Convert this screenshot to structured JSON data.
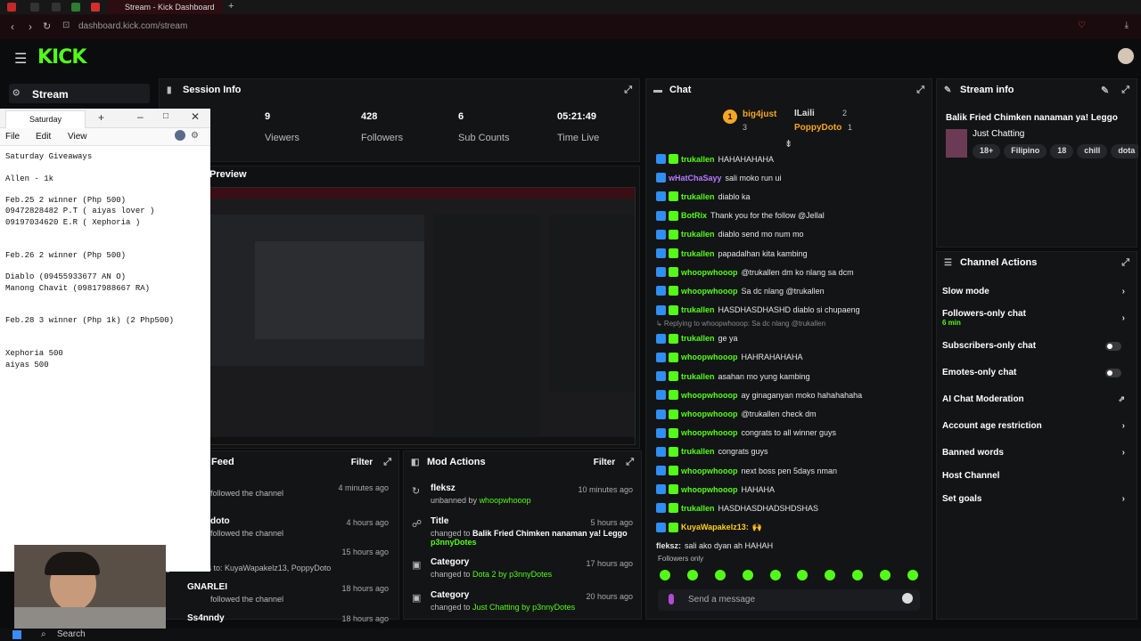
{
  "browser": {
    "tab_title": "Stream - Kick Dashboard",
    "url": "dashboard.kick.com/stream"
  },
  "brand": {
    "logo_text": "KICK",
    "accent": "#53fc18"
  },
  "sidebar": {
    "stream_label": "Stream"
  },
  "session": {
    "title": "Session Info",
    "stats": [
      {
        "value": "9",
        "label": "Viewers"
      },
      {
        "value": "428",
        "label": "Followers"
      },
      {
        "value": "6",
        "label": "Sub Counts"
      },
      {
        "value": "05:21:49",
        "label": "Time Live"
      }
    ],
    "preview_label": "Preview"
  },
  "notepad": {
    "tab_title": "Saturday",
    "menu": [
      "File",
      "Edit",
      "View"
    ],
    "lines": [
      "Saturday Giveaways",
      "",
      "Allen - 1k",
      "",
      "Feb.25 2 winner (Php 500)",
      "09472828482 P.T ( aiyas lover )",
      "09197034620 E.R ( Xephoria )",
      "",
      "",
      "Feb.26 2 winner (Php 500)",
      "",
      "Diablo (09455933677 AN O)",
      "Manong Chavit (09817988667 RA)",
      "",
      "",
      "Feb.28 3 winner (Php 1k) (2 Php500)",
      "",
      "",
      "Xephoria 500",
      "aiyas 500"
    ]
  },
  "feed": {
    "title": "Feed",
    "filter_label": "Filter",
    "items": [
      {
        "title": "",
        "sub": "followed the channel",
        "time": "4 minutes ago"
      },
      {
        "title": "doto",
        "sub": "followed the channel",
        "time": "4 hours ago"
      },
      {
        "title": "",
        "sub": "gifted 2 subs to: KuyaWapakelz13, PoppyDoto",
        "time": "15 hours ago"
      },
      {
        "title": "GNARLEI",
        "sub": "followed the channel",
        "time": "18 hours ago"
      },
      {
        "title": "Ss4nndy",
        "sub": "",
        "time": "18 hours ago"
      }
    ]
  },
  "mod_actions": {
    "title": "Mod Actions",
    "filter_label": "Filter",
    "items": [
      {
        "title": "fleksz",
        "sub_prefix": "unbanned by ",
        "sub_user": "whoopwhooop",
        "time": "10 minutes ago"
      },
      {
        "title": "Title",
        "sub_prefix": "changed to ",
        "sub_user": "Balik Fried Chimken nanaman ya! Leggo",
        "sub2": "p3nnyDotes",
        "time": "5 hours ago"
      },
      {
        "title": "Category",
        "sub_prefix": "changed to ",
        "sub_user": "Dota 2 by p3nnyDotes",
        "time": "17 hours ago"
      },
      {
        "title": "Category",
        "sub_prefix": "changed to ",
        "sub_user": "Just Chatting by p3nnyDotes",
        "time": "20 hours ago"
      }
    ]
  },
  "chat": {
    "title": "Chat",
    "top_gifters": [
      {
        "rank": "1",
        "name": "big4just",
        "count": "3"
      },
      {
        "rank": "",
        "name": "ILaili",
        "count": "2"
      },
      {
        "rank": "",
        "name": "PoppyDoto",
        "count": "1"
      }
    ],
    "messages": [
      {
        "user": "trukallen",
        "color": "#53fc18",
        "text": "HAHAHAHAHA",
        "badges": [
          "blue",
          "green"
        ]
      },
      {
        "user": "wHatChaSayy",
        "color": "#b57bff",
        "text": "sali moko run ui",
        "badges": [
          "blue"
        ]
      },
      {
        "user": "trukallen",
        "color": "#53fc18",
        "text": "diablo ka",
        "badges": [
          "blue",
          "green"
        ]
      },
      {
        "user": "BotRix",
        "color": "#53fc18",
        "text": "Thank you for the follow @Jellal",
        "badges": [
          "blue",
          "green"
        ]
      },
      {
        "user": "trukallen",
        "color": "#53fc18",
        "text": "diablo send mo num mo",
        "badges": [
          "blue",
          "green"
        ]
      },
      {
        "user": "trukallen",
        "color": "#53fc18",
        "text": "papadalhan kita kambing",
        "badges": [
          "blue",
          "green"
        ]
      },
      {
        "user": "whoopwhooop",
        "color": "#53fc18",
        "text": "@trukallen dm ko nlang sa dcm",
        "badges": [
          "blue",
          "green"
        ]
      },
      {
        "user": "whoopwhooop",
        "color": "#53fc18",
        "text": "Sa dc nlang @trukallen",
        "badges": [
          "blue",
          "green"
        ]
      },
      {
        "user": "trukallen",
        "color": "#53fc18",
        "text": "HASDHASDHASHD diablo si chupaeng",
        "badges": [
          "blue",
          "green"
        ]
      },
      {
        "user": "trukallen",
        "color": "#53fc18",
        "text": "ge ya",
        "badges": [
          "blue",
          "green"
        ],
        "reply": "Replying to whoopwhooop: Sa dc nlang @trukallen"
      },
      {
        "user": "whoopwhooop",
        "color": "#53fc18",
        "text": "HAHRAHAHAHA",
        "badges": [
          "blue",
          "green"
        ]
      },
      {
        "user": "trukallen",
        "color": "#53fc18",
        "text": "asahan mo yung kambing",
        "badges": [
          "blue",
          "green"
        ]
      },
      {
        "user": "whoopwhooop",
        "color": "#53fc18",
        "text": "ay ginaganyan moko hahahahaha",
        "badges": [
          "blue",
          "green"
        ]
      },
      {
        "user": "whoopwhooop",
        "color": "#53fc18",
        "text": "@trukallen check dm",
        "badges": [
          "blue",
          "green"
        ]
      },
      {
        "user": "whoopwhooop",
        "color": "#53fc18",
        "text": "congrats to all winner guys",
        "badges": [
          "blue",
          "green"
        ]
      },
      {
        "user": "trukallen",
        "color": "#53fc18",
        "text": "congrats guys",
        "badges": [
          "blue",
          "green"
        ]
      },
      {
        "user": "whoopwhooop",
        "color": "#53fc18",
        "text": "next boss pen 5days nman",
        "badges": [
          "blue",
          "green"
        ]
      },
      {
        "user": "whoopwhooop",
        "color": "#53fc18",
        "text": "HAHAHA",
        "badges": [
          "blue",
          "green"
        ]
      },
      {
        "user": "trukallen",
        "color": "#53fc18",
        "text": "HASDHASDHADSHDSHAS",
        "badges": [
          "blue",
          "green"
        ]
      },
      {
        "user": "KuyaWapakelz13:",
        "color": "#ffd11a",
        "text": "🙌",
        "badges": [
          "blue",
          "green"
        ]
      },
      {
        "user": "fleksz:",
        "color": "#e6e6e6",
        "text": "sali ako dyan ah HAHAH",
        "badges": []
      }
    ],
    "followers_only_label": "Followers only",
    "send_placeholder": "Send a message"
  },
  "stream_info": {
    "title": "Stream info",
    "stream_title": "Balik Fried Chimken nanaman ya! Leggo",
    "category": "Just Chatting",
    "tags": [
      "18+",
      "Filipino",
      "18",
      "chill",
      "dota"
    ]
  },
  "channel_actions": {
    "title": "Channel Actions",
    "items": [
      {
        "label": "Slow mode",
        "kind": "arrow"
      },
      {
        "label": "Followers-only chat",
        "sub": "6 min",
        "kind": "arrow"
      },
      {
        "label": "Subscribers-only chat",
        "kind": "toggle"
      },
      {
        "label": "Emotes-only chat",
        "kind": "toggle"
      },
      {
        "label": "AI Chat Moderation",
        "kind": "link"
      },
      {
        "label": "Account age restriction",
        "kind": "arrow"
      },
      {
        "label": "Banned words",
        "kind": "arrow"
      },
      {
        "label": "Host Channel",
        "kind": "none"
      },
      {
        "label": "Set goals",
        "kind": "arrow"
      }
    ]
  },
  "taskbar": {
    "search_label": "Search"
  }
}
